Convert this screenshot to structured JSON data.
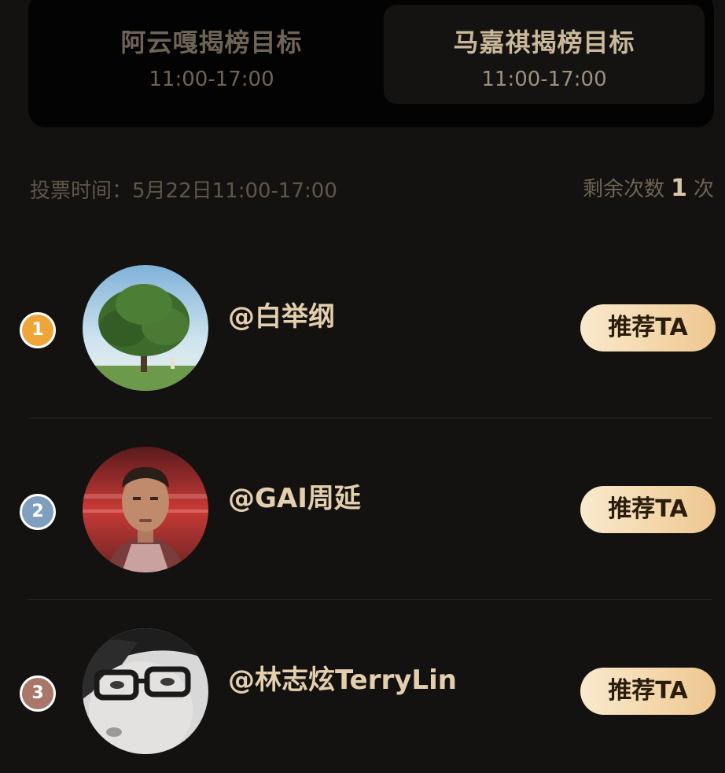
{
  "tabs": [
    {
      "title": "阿云嘎揭榜目标",
      "time": "11:00-17:00",
      "active": false
    },
    {
      "title": "马嘉祺揭榜目标",
      "time": "11:00-17:00",
      "active": true
    }
  ],
  "vote": {
    "time_text": "投票时间：5月22日11:00-17:00",
    "remaining_prefix": "剩余次数",
    "remaining_count": "1",
    "remaining_suffix": "次"
  },
  "list": [
    {
      "rank": "1",
      "name": "@白举纲",
      "button": "推荐TA",
      "avatar_icon": "tree-avatar"
    },
    {
      "rank": "2",
      "name": "@GAI周延",
      "button": "推荐TA",
      "avatar_icon": "man-portrait-avatar"
    },
    {
      "rank": "3",
      "name": "@林志炫TerryLin",
      "button": "推荐TA",
      "avatar_icon": "glasses-portrait-avatar"
    }
  ],
  "colors": {
    "background": "#141210",
    "gold_text": "#e3cfae",
    "rank_1": "#eea63a",
    "rank_2": "#7f9fbe",
    "rank_3": "#a9766a",
    "button_gradient_start": "#f9e9cd",
    "button_gradient_end": "#eec690"
  }
}
